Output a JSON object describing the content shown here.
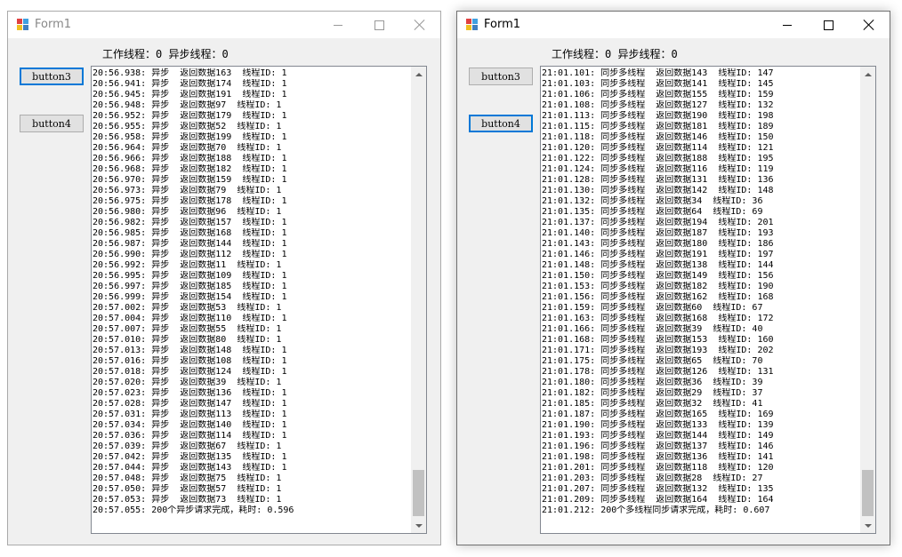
{
  "windows": [
    {
      "title": "Form1",
      "status": "工作线程：0 异步线程：0",
      "button3": "button3",
      "button4": "button4",
      "lines": [
        "20:56.938: 异步  返回数据163  线程ID: 1",
        "20:56.941: 异步  返回数据174  线程ID: 1",
        "20:56.945: 异步  返回数据191  线程ID: 1",
        "20:56.948: 异步  返回数据97  线程ID: 1",
        "20:56.952: 异步  返回数据179  线程ID: 1",
        "20:56.955: 异步  返回数据52  线程ID: 1",
        "20:56.958: 异步  返回数据199  线程ID: 1",
        "20:56.964: 异步  返回数据70  线程ID: 1",
        "20:56.966: 异步  返回数据188  线程ID: 1",
        "20:56.968: 异步  返回数据182  线程ID: 1",
        "20:56.970: 异步  返回数据159  线程ID: 1",
        "20:56.973: 异步  返回数据79  线程ID: 1",
        "20:56.975: 异步  返回数据178  线程ID: 1",
        "20:56.980: 异步  返回数据96  线程ID: 1",
        "20:56.982: 异步  返回数据157  线程ID: 1",
        "20:56.985: 异步  返回数据168  线程ID: 1",
        "20:56.987: 异步  返回数据144  线程ID: 1",
        "20:56.990: 异步  返回数据112  线程ID: 1",
        "20:56.992: 异步  返回数据11  线程ID: 1",
        "20:56.995: 异步  返回数据109  线程ID: 1",
        "20:56.997: 异步  返回数据185  线程ID: 1",
        "20:56.999: 异步  返回数据154  线程ID: 1",
        "20:57.002: 异步  返回数据53  线程ID: 1",
        "20:57.004: 异步  返回数据110  线程ID: 1",
        "20:57.007: 异步  返回数据55  线程ID: 1",
        "20:57.010: 异步  返回数据80  线程ID: 1",
        "20:57.013: 异步  返回数据148  线程ID: 1",
        "20:57.016: 异步  返回数据108  线程ID: 1",
        "20:57.018: 异步  返回数据124  线程ID: 1",
        "20:57.020: 异步  返回数据39  线程ID: 1",
        "20:57.023: 异步  返回数据136  线程ID: 1",
        "20:57.028: 异步  返回数据147  线程ID: 1",
        "20:57.031: 异步  返回数据113  线程ID: 1",
        "20:57.034: 异步  返回数据140  线程ID: 1",
        "20:57.036: 异步  返回数据114  线程ID: 1",
        "20:57.039: 异步  返回数据67  线程ID: 1",
        "20:57.042: 异步  返回数据135  线程ID: 1",
        "20:57.044: 异步  返回数据143  线程ID: 1",
        "20:57.048: 异步  返回数据75  线程ID: 1",
        "20:57.050: 异步  返回数据57  线程ID: 1",
        "20:57.053: 异步  返回数据73  线程ID: 1",
        "20:57.055: 200个异步请求完成，耗时: 0.596"
      ]
    },
    {
      "title": "Form1",
      "status": "工作线程：0 异步线程：0",
      "button3": "button3",
      "button4": "button4",
      "lines": [
        "21:01.101: 同步多线程  返回数据143  线程ID: 147",
        "21:01.103: 同步多线程  返回数据141  线程ID: 145",
        "21:01.106: 同步多线程  返回数据155  线程ID: 159",
        "21:01.108: 同步多线程  返回数据127  线程ID: 132",
        "21:01.113: 同步多线程  返回数据190  线程ID: 198",
        "21:01.115: 同步多线程  返回数据181  线程ID: 189",
        "21:01.118: 同步多线程  返回数据146  线程ID: 150",
        "21:01.120: 同步多线程  返回数据114  线程ID: 121",
        "21:01.122: 同步多线程  返回数据188  线程ID: 195",
        "21:01.124: 同步多线程  返回数据116  线程ID: 119",
        "21:01.128: 同步多线程  返回数据131  线程ID: 136",
        "21:01.130: 同步多线程  返回数据142  线程ID: 148",
        "21:01.132: 同步多线程  返回数据34  线程ID: 36",
        "21:01.135: 同步多线程  返回数据64  线程ID: 69",
        "21:01.137: 同步多线程  返回数据194  线程ID: 201",
        "21:01.140: 同步多线程  返回数据187  线程ID: 193",
        "21:01.143: 同步多线程  返回数据180  线程ID: 186",
        "21:01.146: 同步多线程  返回数据191  线程ID: 197",
        "21:01.148: 同步多线程  返回数据138  线程ID: 144",
        "21:01.150: 同步多线程  返回数据149  线程ID: 156",
        "21:01.153: 同步多线程  返回数据182  线程ID: 190",
        "21:01.156: 同步多线程  返回数据162  线程ID: 168",
        "21:01.159: 同步多线程  返回数据60  线程ID: 67",
        "21:01.163: 同步多线程  返回数据168  线程ID: 172",
        "21:01.166: 同步多线程  返回数据39  线程ID: 40",
        "21:01.168: 同步多线程  返回数据153  线程ID: 160",
        "21:01.171: 同步多线程  返回数据193  线程ID: 202",
        "21:01.175: 同步多线程  返回数据65  线程ID: 70",
        "21:01.178: 同步多线程  返回数据126  线程ID: 131",
        "21:01.180: 同步多线程  返回数据36  线程ID: 39",
        "21:01.182: 同步多线程  返回数据29  线程ID: 37",
        "21:01.185: 同步多线程  返回数据32  线程ID: 41",
        "21:01.187: 同步多线程  返回数据165  线程ID: 169",
        "21:01.190: 同步多线程  返回数据133  线程ID: 139",
        "21:01.193: 同步多线程  返回数据144  线程ID: 149",
        "21:01.196: 同步多线程  返回数据137  线程ID: 146",
        "21:01.198: 同步多线程  返回数据136  线程ID: 141",
        "21:01.201: 同步多线程  返回数据118  线程ID: 120",
        "21:01.203: 同步多线程  返回数据28  线程ID: 27",
        "21:01.207: 同步多线程  返回数据132  线程ID: 135",
        "21:01.209: 同步多线程  返回数据164  线程ID: 164",
        "21:01.212: 200个多线程同步请求完成，耗时: 0.607"
      ]
    }
  ]
}
